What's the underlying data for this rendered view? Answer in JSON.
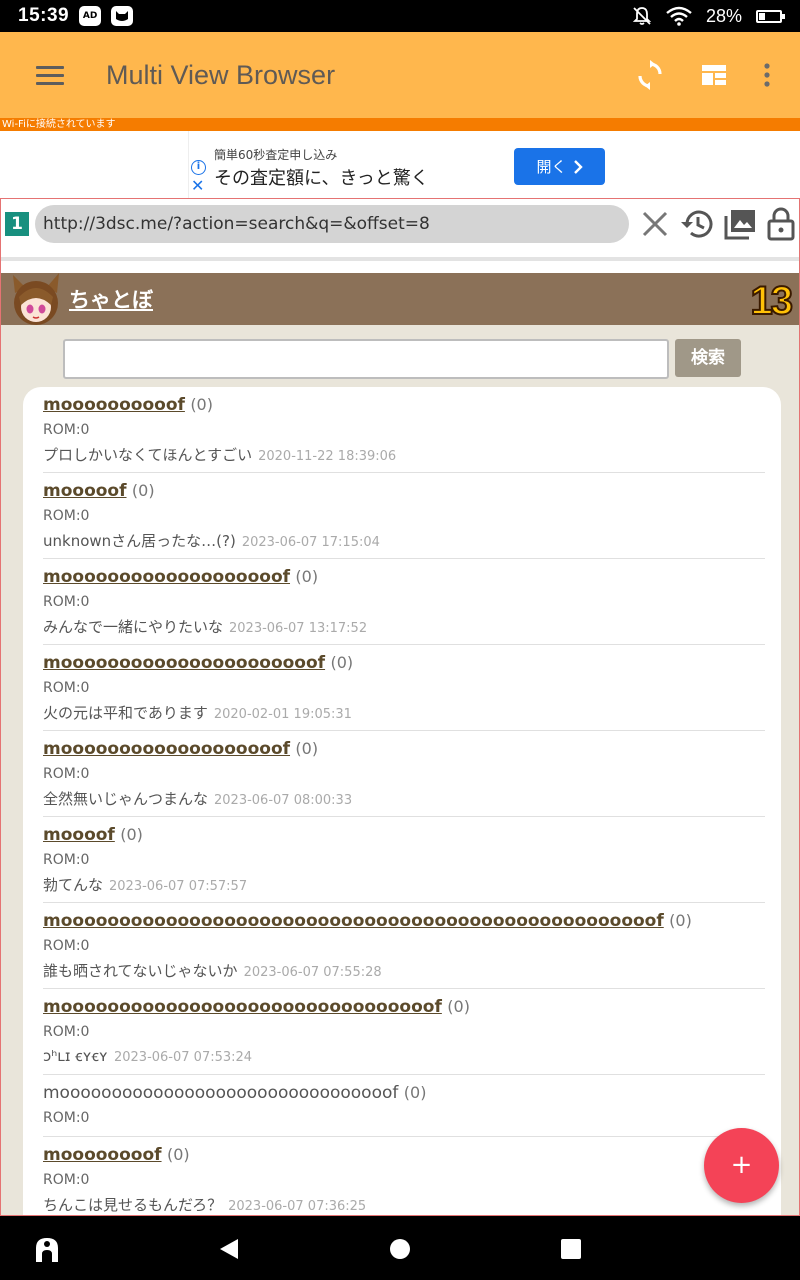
{
  "status": {
    "time": "15:39",
    "left_icons": [
      "ad-icon",
      "cat-icon"
    ],
    "ad_icon_text": "AD",
    "battery": "28%",
    "battery_level": 0.28
  },
  "appbar": {
    "title": "Multi View Browser"
  },
  "wifi_strip": "Wi-Fiに接続されています",
  "ad": {
    "small_text": "簡単60秒査定申し込み",
    "main_text": "その査定額に、きっと驚く",
    "button_label": "開く"
  },
  "urlbar": {
    "tab_number": "1",
    "url": "http://3dsc.me/?action=search&q=&offset=8"
  },
  "site": {
    "name": "ちゃとぼ",
    "counter": "13"
  },
  "search": {
    "value": "",
    "button_label": "検索"
  },
  "entries": [
    {
      "name": "moooooooooof",
      "count": "(0)",
      "rom": "ROM:0",
      "message": "プロしかいなくてほんとすごい",
      "date": "2020-11-22 18:39:06",
      "linked": true
    },
    {
      "name": "mooooof",
      "count": "(0)",
      "rom": "ROM:0",
      "message": "unknownさん居ったな…(?)",
      "date": "2023-06-07 17:15:04",
      "linked": true
    },
    {
      "name": "mooooooooooooooooooof",
      "count": "(0)",
      "rom": "ROM:0",
      "message": "みんなで一緒にやりたいな",
      "date": "2023-06-07 13:17:52",
      "linked": true
    },
    {
      "name": "moooooooooooooooooooooof",
      "count": "(0)",
      "rom": "ROM:0",
      "message": "火の元は平和であります",
      "date": "2020-02-01 19:05:31",
      "linked": true
    },
    {
      "name": "mooooooooooooooooooof",
      "count": "(0)",
      "rom": "ROM:0",
      "message": "全然無いじゃんつまんな",
      "date": "2023-06-07 08:00:33",
      "linked": true
    },
    {
      "name": "moooof",
      "count": "(0)",
      "rom": "ROM:0",
      "message": "勃てんな",
      "date": "2023-06-07 07:57:57",
      "linked": true
    },
    {
      "name": "mooooooooooooooooooooooooooooooooooooooooooooooooooof",
      "count": "(0)",
      "rom": "ROM:0",
      "message": "誰も晒されてないじゃないか",
      "date": "2023-06-07 07:55:28",
      "linked": true
    },
    {
      "name": "moooooooooooooooooooooooooooooooof",
      "count": "(0)",
      "rom": "ROM:0",
      "message": "ɔʰʟɪ ꞓʏꞓʏ",
      "date": "2023-06-07 07:53:24",
      "linked": true
    },
    {
      "name": "moooooooooooooooooooooooooooooooof",
      "count": "(0)",
      "rom": "ROM:0",
      "message": "",
      "date": "",
      "linked": false
    },
    {
      "name": "moooooooof",
      "count": "(0)",
      "rom": "ROM:0",
      "message": "ちんこは見せるもんだろ？",
      "date": "2023-06-07 07:36:25",
      "linked": true
    }
  ],
  "fab_label": "+",
  "colors": {
    "appbar": "#FFB74D",
    "wifi_strip": "#F57C00",
    "site_header": "#8B7158",
    "content_bg": "#E9E5DA",
    "fab": "#F44357",
    "tab_badge": "#18907F"
  }
}
